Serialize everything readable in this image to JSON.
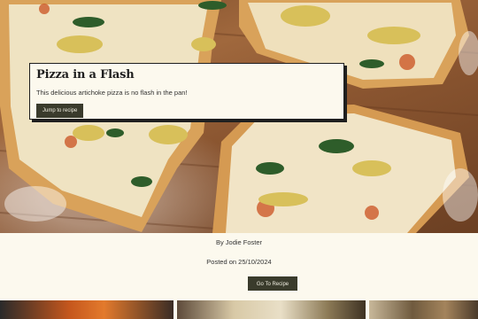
{
  "hero": {
    "title": "Pizza in a Flash",
    "subtitle": "This delicious artichoke pizza is no flash in the pan!",
    "jump_label": "Jump to recipe"
  },
  "post": {
    "author": "By Jodie Foster",
    "posted": "Posted on 25/10/2024",
    "go_label": "Go To Recipe"
  },
  "thumbnails": [
    {
      "name": "recipe-thumbnail-1"
    },
    {
      "name": "recipe-thumbnail-2"
    },
    {
      "name": "recipe-thumbnail-3"
    }
  ],
  "colors": {
    "page_bg": "#fcf9ee",
    "button_bg": "#3a3b2c",
    "button_text": "#f2efe2",
    "text": "#333333"
  }
}
